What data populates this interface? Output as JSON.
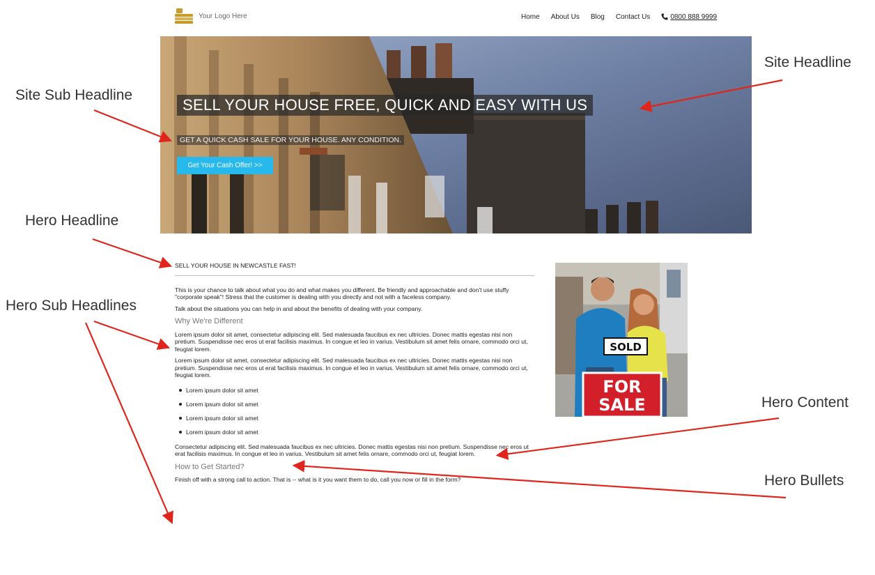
{
  "header": {
    "logo_text": "Your Logo Here",
    "nav": [
      "Home",
      "About Us",
      "Blog",
      "Contact Us"
    ],
    "phone": "0800 888 9999"
  },
  "hero": {
    "headline": "SELL YOUR HOUSE FREE, QUICK AND EASY WITH US",
    "subheadline": "GET A QUICK CASH SALE FOR YOUR HOUSE. ANY CONDITION.",
    "cta_label": "Get Your Cash Offer! >>"
  },
  "content": {
    "hero_headline": "SELL YOUR HOUSE IN NEWCASTLE FAST!",
    "intro_1": "This is your chance to talk about what you do and what makes you different. Be friendly and approachable and don't use stuffy \"corporate speak\"! Stress that the customer is dealing with you directly and not with a faceless company.",
    "intro_2": "Talk about the situations you can help in and about the benefits of dealing with your company.",
    "subhead_1": "Why We're Different",
    "para_1": "Lorem ipsum dolor sit amet, consectetur adipiscing elit. Sed malesuada faucibus ex nec ultricies. Donec mattis egestas nisi non pretium. Suspendisse nec eros ut erat facilisis maximus. In congue et leo in varius. Vestibulum sit amet felis ornare, commodo orci ut, feugiat lorem.",
    "para_2": "Lorem ipsum dolor sit amet, consectetur adipiscing elit. Sed malesuada faucibus ex nec ultricies. Donec mattis egestas nisi non pretium. Suspendisse nec eros ut erat facilisis maximus. In congue et leo in varius. Vestibulum sit amet felis ornare, commodo orci ut, feugiat lorem.",
    "bullets": [
      "Lorem ipsum dolor sit amet",
      "Lorem ipsum dolor sit amet",
      "Lorem ipsum dolor sit amet",
      "Lorem ipsum dolor sit amet"
    ],
    "para_3": "Consectetur adipiscing elit. Sed malesuada faucibus ex nec ultricies. Donec mattis egestas nisi non pretium. Suspendisse nec eros ut erat facilisis maximus. In congue et leo in varius. Vestibulum sit amet felis ornare, commodo orci ut, feugiat lorem.",
    "subhead_2": "How to Get Started?",
    "para_4": "Finish off with a strong call to action. That is -- what is it you want them to do, call you now or fill in the form?"
  },
  "photo": {
    "sign_sold": "SOLD",
    "sign_for": "FOR",
    "sign_sale": "SALE"
  },
  "annotations": {
    "site_sub_headline": "Site Sub Headline",
    "site_headline": "Site Headline",
    "hero_headline": "Hero Headline",
    "hero_sub_headlines": "Hero Sub Headlines",
    "hero_content": "Hero Content",
    "hero_bullets": "Hero Bullets"
  },
  "colors": {
    "cta": "#27b9ec",
    "annotation_arrow": "#e0261c",
    "logo_gold": "#c79a2b"
  }
}
